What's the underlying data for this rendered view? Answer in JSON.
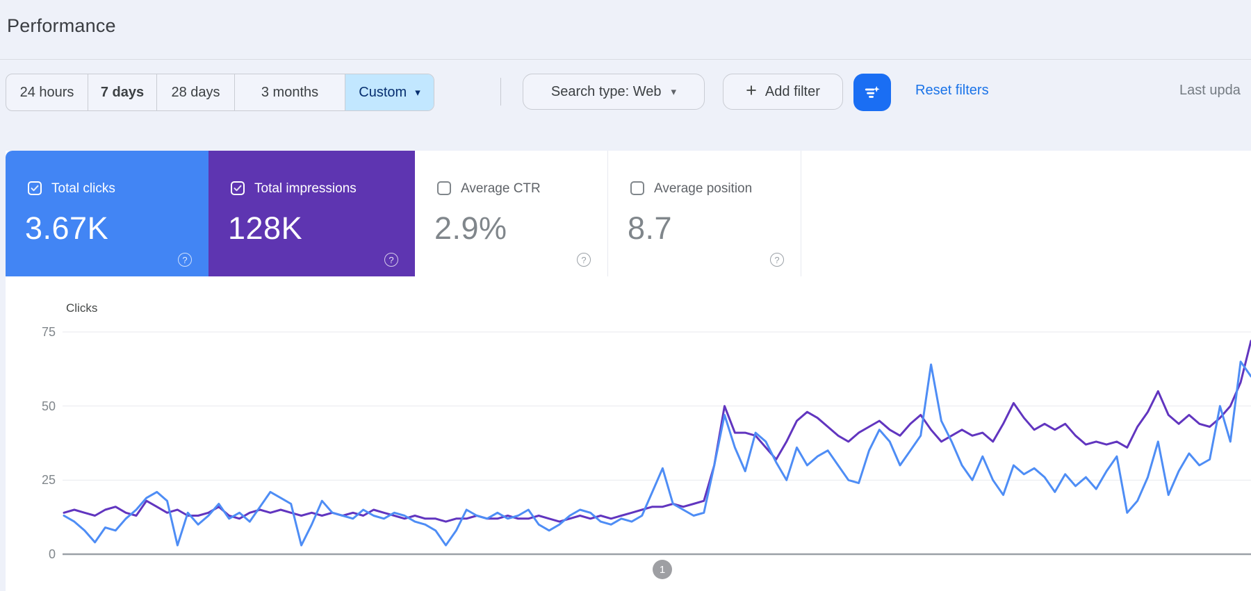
{
  "header": {
    "title": "Performance"
  },
  "toolbar": {
    "date_ranges": [
      {
        "label": "24 hours",
        "selected": false,
        "bold": false
      },
      {
        "label": "7 days",
        "selected": false,
        "bold": true
      },
      {
        "label": "28 days",
        "selected": false,
        "bold": false
      },
      {
        "label": "3 months",
        "selected": false,
        "bold": false
      },
      {
        "label": "Custom",
        "selected": true,
        "bold": false
      }
    ],
    "search_type_label": "Search type: Web",
    "add_filter_label": "Add filter",
    "plus_glyph": "+",
    "caret_glyph": "▾",
    "filter_button_color": "#1a6ef3",
    "reset_label": "Reset filters",
    "reset_color": "#1a73e8",
    "last_updated_partial": "Last upda"
  },
  "cards": [
    {
      "label": "Total clicks",
      "value": "3.67K",
      "selected": true,
      "color": "#4285f4",
      "help_glyph": "?"
    },
    {
      "label": "Total impressions",
      "value": "128K",
      "selected": true,
      "color": "#5e35b1",
      "help_glyph": "?"
    },
    {
      "label": "Average CTR",
      "value": "2.9%",
      "selected": false,
      "color": "",
      "help_glyph": "?"
    },
    {
      "label": "Average position",
      "value": "8.7",
      "selected": false,
      "color": "",
      "help_glyph": "?"
    }
  ],
  "pagination": {
    "current_page": "1"
  },
  "chart_data": {
    "type": "line",
    "title": "Clicks",
    "ylabel": "Clicks",
    "xlabel": "",
    "ylim": [
      0,
      75
    ],
    "yticks": [
      0,
      25,
      50,
      75
    ],
    "grid": true,
    "legend": "none",
    "x_note": "daily points over custom date range; date axis labels not visible in screenshot",
    "series": [
      {
        "name": "Total clicks",
        "color": "#4e8df5",
        "values": [
          13,
          11,
          8,
          4,
          9,
          8,
          12,
          15,
          19,
          21,
          18,
          3,
          14,
          10,
          13,
          17,
          12,
          14,
          11,
          16,
          21,
          19,
          17,
          3,
          10,
          18,
          14,
          13,
          12,
          15,
          13,
          12,
          14,
          13,
          11,
          10,
          8,
          3,
          8,
          15,
          13,
          12,
          14,
          12,
          13,
          15,
          10,
          8,
          10,
          13,
          15,
          14,
          11,
          10,
          12,
          11,
          13,
          21,
          29,
          17,
          15,
          13,
          14,
          30,
          47,
          36,
          28,
          41,
          38,
          31,
          25,
          36,
          30,
          33,
          35,
          30,
          25,
          24,
          35,
          42,
          38,
          30,
          35,
          40,
          64,
          45,
          38,
          30,
          25,
          33,
          25,
          20,
          30,
          27,
          29,
          26,
          21,
          27,
          23,
          26,
          22,
          28,
          33,
          14,
          18,
          26,
          38,
          20,
          28,
          34,
          30,
          32,
          50,
          38,
          65,
          60
        ]
      },
      {
        "name": "Total impressions",
        "color": "#6135bf",
        "values": [
          14,
          15,
          14,
          13,
          15,
          16,
          14,
          13,
          18,
          16,
          14,
          15,
          13,
          13,
          14,
          16,
          13,
          12,
          14,
          15,
          14,
          15,
          14,
          13,
          14,
          13,
          14,
          13,
          14,
          13,
          15,
          14,
          13,
          12,
          13,
          12,
          12,
          11,
          12,
          12,
          13,
          12,
          12,
          13,
          12,
          12,
          13,
          12,
          11,
          12,
          13,
          12,
          13,
          12,
          13,
          14,
          15,
          16,
          16,
          17,
          16,
          17,
          18,
          30,
          50,
          41,
          41,
          40,
          36,
          32,
          38,
          45,
          48,
          46,
          43,
          40,
          38,
          41,
          43,
          45,
          42,
          40,
          44,
          47,
          42,
          38,
          40,
          42,
          40,
          41,
          38,
          44,
          51,
          46,
          42,
          44,
          42,
          44,
          40,
          37,
          38,
          37,
          38,
          36,
          43,
          48,
          55,
          47,
          44,
          47,
          44,
          43,
          46,
          50,
          58,
          72
        ]
      }
    ]
  }
}
